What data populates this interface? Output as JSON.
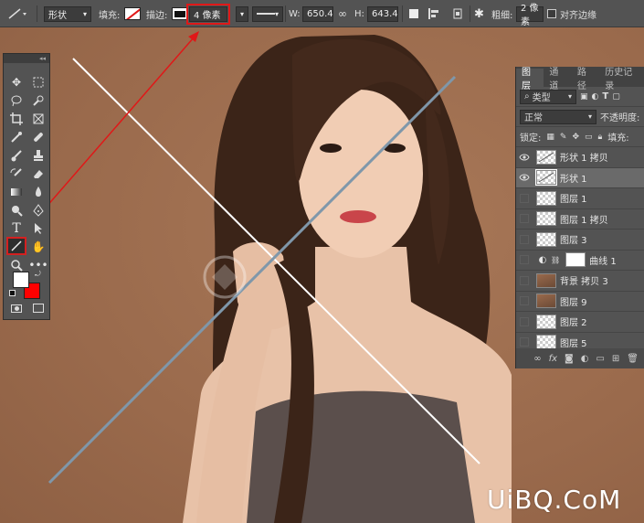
{
  "options_bar": {
    "shape_mode": "形状",
    "fill_label": "填充:",
    "stroke_label": "描边:",
    "stroke_width": "4 像素",
    "width_label": "W:",
    "width_value": "650.4",
    "height_label": "H:",
    "height_value": "643.4",
    "weight_label": "粗细:",
    "weight_value": "2 像素",
    "align_edges_label": "对齐边缘"
  },
  "layers_panel": {
    "tabs": [
      "图层",
      "通道",
      "路径",
      "历史记录"
    ],
    "filter_kind": "类型",
    "blend_mode": "正常",
    "opacity_label": "不透明度:",
    "lock_label": "锁定:",
    "fill_label": "填充:",
    "layers": [
      {
        "name": "形状 1 拷贝",
        "visible": true,
        "thumb": "shape",
        "selected": false
      },
      {
        "name": "形状 1",
        "visible": true,
        "thumb": "shape",
        "selected": true
      },
      {
        "name": "图层 1",
        "visible": false,
        "thumb": "transparent",
        "selected": false
      },
      {
        "name": "图层 1 拷贝",
        "visible": false,
        "thumb": "transparent",
        "selected": false
      },
      {
        "name": "图层 3",
        "visible": false,
        "thumb": "transparent",
        "selected": false
      },
      {
        "name": "曲线 1",
        "visible": false,
        "thumb": "adjustment",
        "selected": false
      },
      {
        "name": "背景 拷贝 3",
        "visible": false,
        "thumb": "photo",
        "selected": false
      },
      {
        "name": "图层 9",
        "visible": false,
        "thumb": "photo",
        "selected": false
      },
      {
        "name": "图层 2",
        "visible": false,
        "thumb": "transparent",
        "selected": false
      },
      {
        "name": "图层 5",
        "visible": false,
        "thumb": "transparent",
        "selected": false
      }
    ],
    "footer_fx": "fx"
  },
  "watermark": "UiBQ.CoM",
  "colors": {
    "accent_red": "#e01818",
    "panel_bg": "#535353",
    "canvas_bg": "#a07255",
    "foreground": "#ffffff",
    "background": "#ff0000"
  }
}
